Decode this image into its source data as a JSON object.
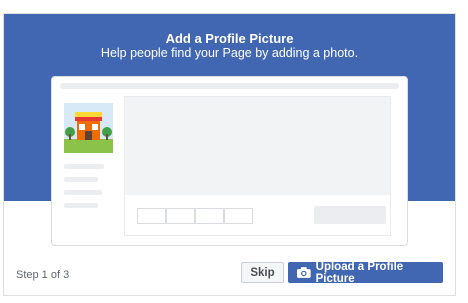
{
  "dialog": {
    "title": "Add a Profile Picture",
    "subtitle": "Help people find your Page by adding a photo."
  },
  "footer": {
    "step_text": "Step 1 of 3",
    "skip_label": "Skip",
    "upload_label": "Upload a Profile Picture"
  },
  "colors": {
    "brand_blue": "#4267b2",
    "placeholder_gray": "#ebedf0"
  },
  "icons": {
    "upload_button_icon": "camera-icon",
    "profile_placeholder": "storefront-illustration"
  }
}
